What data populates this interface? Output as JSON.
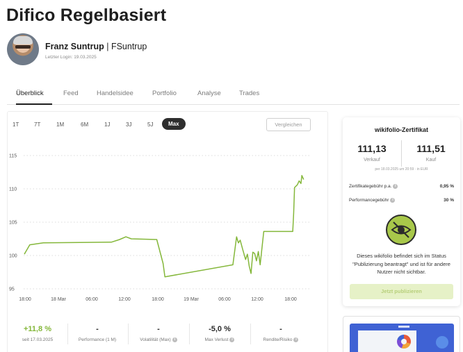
{
  "page": {
    "title": "Difico Regelbasiert"
  },
  "trader": {
    "name": "Franz Suntrup",
    "separator": "|",
    "handle": "FSuntrup",
    "last_login": "Letzter Login: 19.03.2025"
  },
  "tabs": [
    {
      "label": "Überblick",
      "active": true
    },
    {
      "label": "Feed"
    },
    {
      "label": "Handelsidee"
    },
    {
      "label": "Portfolio"
    },
    {
      "label": "Analyse"
    },
    {
      "label": "Trades"
    }
  ],
  "ranges": [
    "1T",
    "7T",
    "1M",
    "6M",
    "1J",
    "3J",
    "5J",
    "Max"
  ],
  "active_range": "Max",
  "compare_label": "Vergleichen",
  "chart_data": {
    "type": "line",
    "line_color": "#84b73a",
    "ylim": [
      95,
      115
    ],
    "yticks": [
      "115",
      "110",
      "105",
      "100",
      "95"
    ],
    "xticks": [
      "18:00",
      "18 Mar",
      "06:00",
      "12:00",
      "18:00",
      "19 Mar",
      "06:00",
      "12:00",
      "18:00"
    ],
    "grid": "horizontal dotted",
    "series": [
      {
        "points": [
          [
            0,
            100.2
          ],
          [
            0.6,
            101.6
          ],
          [
            2.1,
            101.9
          ],
          [
            9.6,
            102.0
          ],
          [
            10.5,
            102.4
          ],
          [
            11.2,
            102.8
          ],
          [
            11.8,
            102.5
          ],
          [
            14.6,
            102.4
          ],
          [
            15.3,
            98.8
          ],
          [
            15.5,
            96.8
          ],
          [
            23.0,
            98.6
          ],
          [
            23.4,
            102.8
          ],
          [
            23.6,
            101.9
          ],
          [
            23.8,
            102.3
          ],
          [
            24.1,
            100.8
          ],
          [
            24.4,
            99.4
          ],
          [
            24.6,
            100.2
          ],
          [
            24.8,
            98.4
          ],
          [
            25.0,
            97.3
          ],
          [
            25.2,
            100.5
          ],
          [
            25.4,
            100.3
          ],
          [
            25.6,
            99.2
          ],
          [
            25.8,
            100.6
          ],
          [
            26.0,
            98.6
          ],
          [
            26.4,
            103.6
          ],
          [
            29.6,
            103.6
          ],
          [
            29.7,
            106.3
          ],
          [
            29.8,
            110.2
          ],
          [
            30.1,
            110.6
          ],
          [
            30.3,
            111.2
          ],
          [
            30.5,
            110.8
          ],
          [
            30.6,
            112.0
          ],
          [
            30.8,
            111.4
          ]
        ]
      }
    ]
  },
  "stats": [
    {
      "value": "+11,8 %",
      "label": "seit 17.03.2025",
      "highlight": true,
      "info": false
    },
    {
      "value": "-",
      "label": "Performance (1 M)",
      "info": false
    },
    {
      "value": "-",
      "label": "Volatilität (Max)",
      "info": true
    },
    {
      "value": "-5,0 %",
      "label": "Max Verlust",
      "info": true
    },
    {
      "value": "-",
      "label": "Rendite/Risiko",
      "info": true
    }
  ],
  "certificate": {
    "title": "wikifolio-Zertifikat",
    "sell_price": "111,13",
    "sell_label": "Verkauf",
    "buy_price": "111,51",
    "buy_label": "Kauf",
    "price_note": "per 18.03.2025 um 20:59 · in EUR",
    "fee_label": "Zertifikategebühr p.a.",
    "fee_value": "0,95 %",
    "perf_fee_label": "Performancegebühr",
    "perf_fee_value": "30 %",
    "status_message": "Dieses wikifolio befindet sich im Status \"Publizierung beantragt\" und ist für andere Nutzer nicht sichtbar.",
    "publish_label": "Jetzt publizieren",
    "accent_color": "#a8c84a"
  }
}
